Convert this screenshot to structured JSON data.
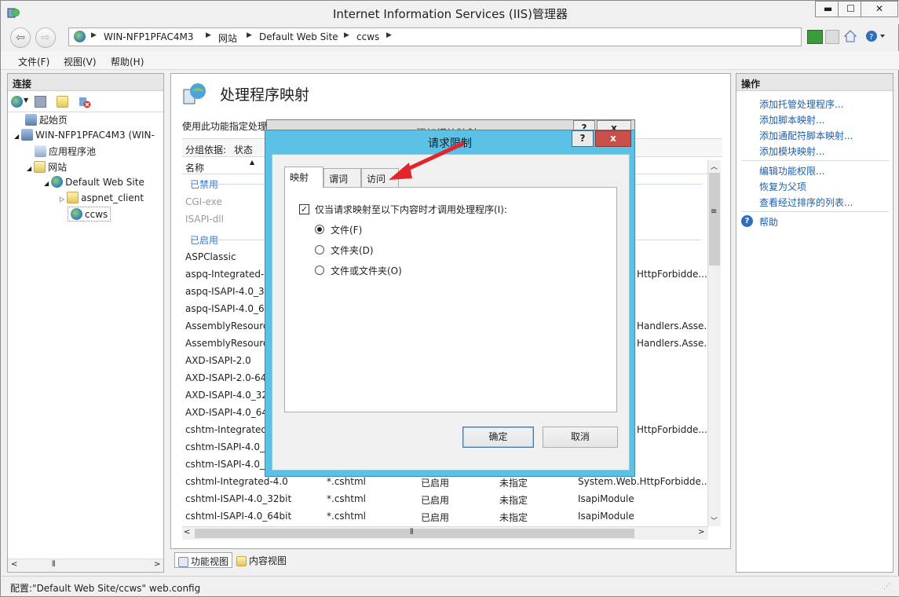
{
  "window": {
    "title": "Internet Information Services (IIS)管理器"
  },
  "address": {
    "crumbs": [
      "WIN-NFP1PFAC4M3",
      "网站",
      "Default Web Site",
      "ccws"
    ]
  },
  "menu": {
    "items": [
      "文件(F)",
      "视图(V)",
      "帮助(H)"
    ]
  },
  "left": {
    "heading": "连接",
    "tree": [
      "起始页",
      "WIN-NFP1PFAC4M3 (WIN-",
      "应用程序池",
      "网站",
      "Default Web Site",
      "aspnet_client",
      "ccws"
    ]
  },
  "main": {
    "title": "处理程序映射",
    "description": "使用此功能指定处理",
    "group_label": "分组依据:",
    "group_value": "状态",
    "col_name": "名称",
    "group_disabled": "已禁用",
    "group_enabled": "已启用",
    "rows_disabled": [
      "CGI-exe",
      "ISAPI-dll"
    ],
    "rows": [
      {
        "name": "ASPClassic",
        "extra": ""
      },
      {
        "name": "aspq-Integrated-4",
        "extra": "HttpForbidde..."
      },
      {
        "name": "aspq-ISAPI-4.0_32",
        "extra": ""
      },
      {
        "name": "aspq-ISAPI-4.0_64",
        "extra": ""
      },
      {
        "name": "AssemblyResourc",
        "extra": "Handlers.Asse..."
      },
      {
        "name": "AssemblyResourc",
        "extra": "Handlers.Asse..."
      },
      {
        "name": "AXD-ISAPI-2.0",
        "extra": ""
      },
      {
        "name": "AXD-ISAPI-2.0-64",
        "extra": ""
      },
      {
        "name": "AXD-ISAPI-4.0_32",
        "extra": ""
      },
      {
        "name": "AXD-ISAPI-4.0_64",
        "extra": ""
      },
      {
        "name": "cshtm-Integrated-",
        "extra": "HttpForbidde..."
      },
      {
        "name": "cshtm-ISAPI-4.0_3",
        "extra": ""
      },
      {
        "name": "cshtm-ISAPI-4.0_6",
        "extra": ""
      }
    ],
    "full_rows": [
      {
        "name": "cshtml-Integrated-4.0",
        "path": "*.cshtml",
        "state": "已启用",
        "type": "未指定",
        "handler": "System.Web.HttpForbidde..."
      },
      {
        "name": "cshtml-ISAPI-4.0_32bit",
        "path": "*.cshtml",
        "state": "已启用",
        "type": "未指定",
        "handler": "IsapiModule"
      },
      {
        "name": "cshtml-ISAPI-4.0_64bit",
        "path": "*.cshtml",
        "state": "已启用",
        "type": "未指定",
        "handler": "IsapiModule"
      }
    ],
    "view_tabs": [
      "功能视图",
      "内容视图"
    ]
  },
  "right": {
    "heading": "操作",
    "actions": [
      "添加托管处理程序...",
      "添加脚本映射...",
      "添加通配符脚本映射...",
      "添加模块映射..."
    ],
    "actions2": [
      "编辑功能权限...",
      "恢复为父项",
      "查看经过排序的列表..."
    ],
    "help": "帮助"
  },
  "back_dialog": {
    "title": "添加模块映射",
    "help": "?",
    "close": "x"
  },
  "dialog": {
    "title": "请求限制",
    "help": "?",
    "close": "x",
    "tabs": [
      "映射",
      "谓词",
      "访问"
    ],
    "checkbox": "仅当请求映射至以下内容时才调用处理程序(I):",
    "checked": true,
    "radios": [
      "文件(F)",
      "文件夹(D)",
      "文件或文件夹(O)"
    ],
    "selected_radio": "文件(F)",
    "ok": "确定",
    "cancel": "取消"
  },
  "status": {
    "text": "配置:\"Default Web Site/ccws\" web.config"
  },
  "colors": {
    "dialog_title": "#5bc2e6",
    "close_red": "#c9504a",
    "link": "#1f5fa8",
    "group": "#3b78c4",
    "arrow": "#e3242b"
  }
}
